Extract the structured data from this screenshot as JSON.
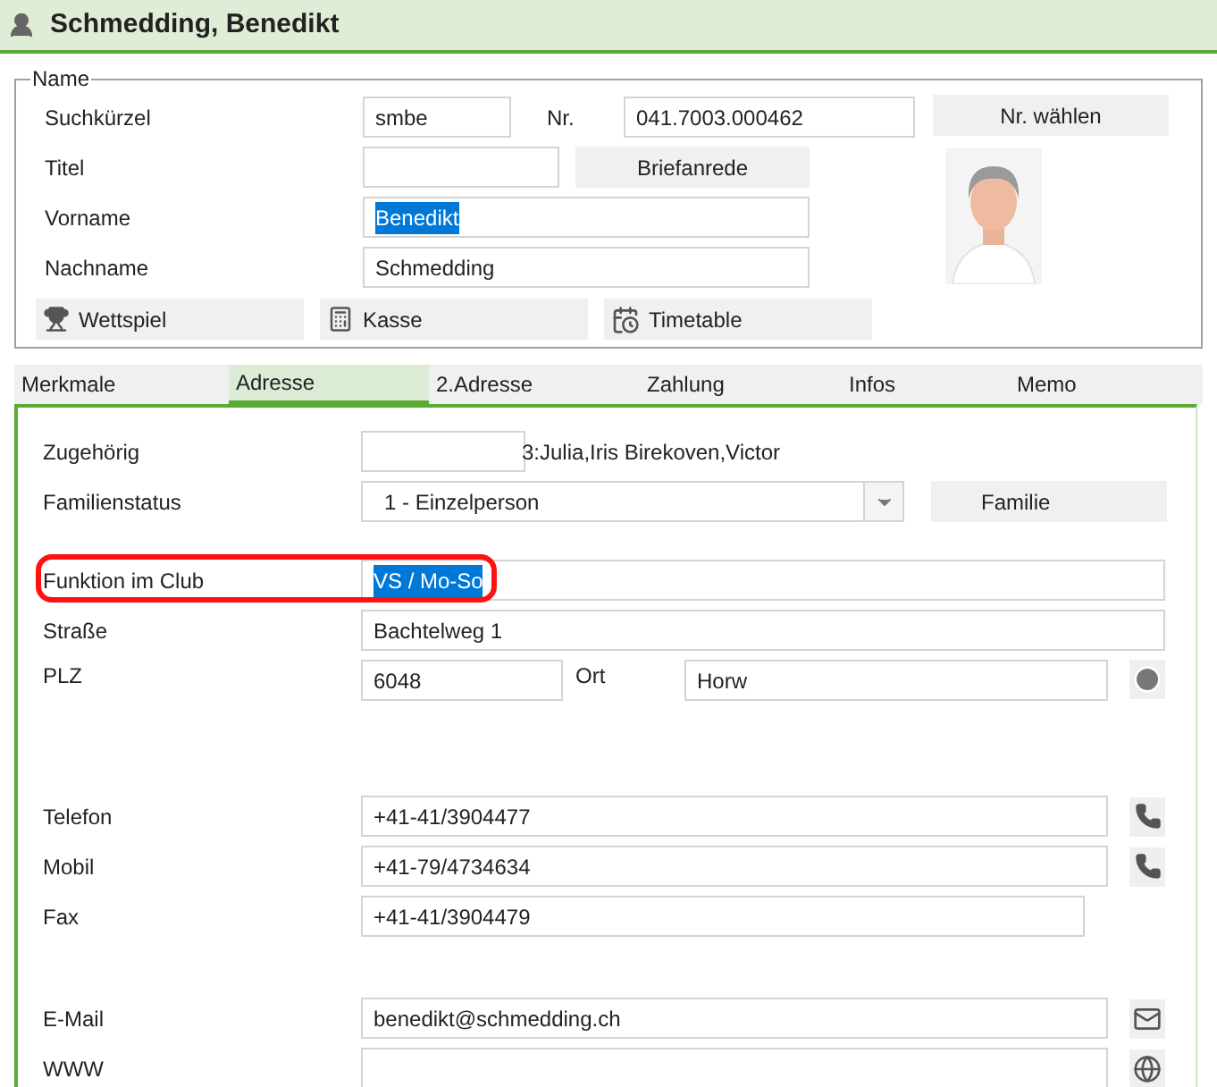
{
  "header": {
    "title": "Schmedding, Benedikt"
  },
  "name_group": {
    "legend": "Name",
    "suchkuerzel": {
      "label": "Suchkürzel",
      "value": "smbe"
    },
    "nr": {
      "label": "Nr.",
      "value": "041.7003.000462",
      "button": "Nr. wählen"
    },
    "titel": {
      "label": "Titel",
      "button": "Briefanrede"
    },
    "vorname": {
      "label": "Vorname",
      "value": "Benedikt",
      "text_selected": true
    },
    "nachname": {
      "label": "Nachname",
      "value": "Schmedding",
      "text_selected": false
    },
    "actions": [
      {
        "label": "Wettspiel"
      },
      {
        "label": "Kasse"
      },
      {
        "label": "Timetable"
      }
    ]
  },
  "tabs": [
    {
      "label": "Merkmale",
      "selected": false
    },
    {
      "label": "Adresse",
      "selected": true
    },
    {
      "label": "2.Adresse",
      "selected": false
    },
    {
      "label": "Zahlung",
      "selected": false
    },
    {
      "label": "Infos",
      "selected": false
    },
    {
      "label": "Memo",
      "selected": false
    }
  ],
  "address": {
    "zugehoerig": {
      "label": "Zugehörig",
      "note": "3:Julia,Iris Birekoven,Victor"
    },
    "familienstatus": {
      "label": "Familienstatus",
      "value": "1 - Einzelperson",
      "button": "Familie"
    },
    "funktion": {
      "label": "Funktion im Club",
      "value": "VS / Mo-So",
      "text_selected": true,
      "highlighted": true
    },
    "strasse": {
      "label": "Straße",
      "value": "Bachtelweg 1"
    },
    "plz": {
      "label": "PLZ",
      "value": "6048"
    },
    "ort": {
      "label": "Ort",
      "value": "Horw"
    },
    "contacts": [
      {
        "label": "Telefon",
        "value": "+41-41/3904477",
        "kind": "phone"
      },
      {
        "label": "Mobil",
        "value": "+41-79/4734634",
        "kind": "phone"
      },
      {
        "label": "Fax",
        "value": "+41-41/3904479",
        "kind": "plain"
      }
    ],
    "online": [
      {
        "label": "E-Mail",
        "value": "benedikt@schmedding.ch",
        "kind": "mail"
      },
      {
        "label": "WWW",
        "kind": "web"
      }
    ]
  }
}
